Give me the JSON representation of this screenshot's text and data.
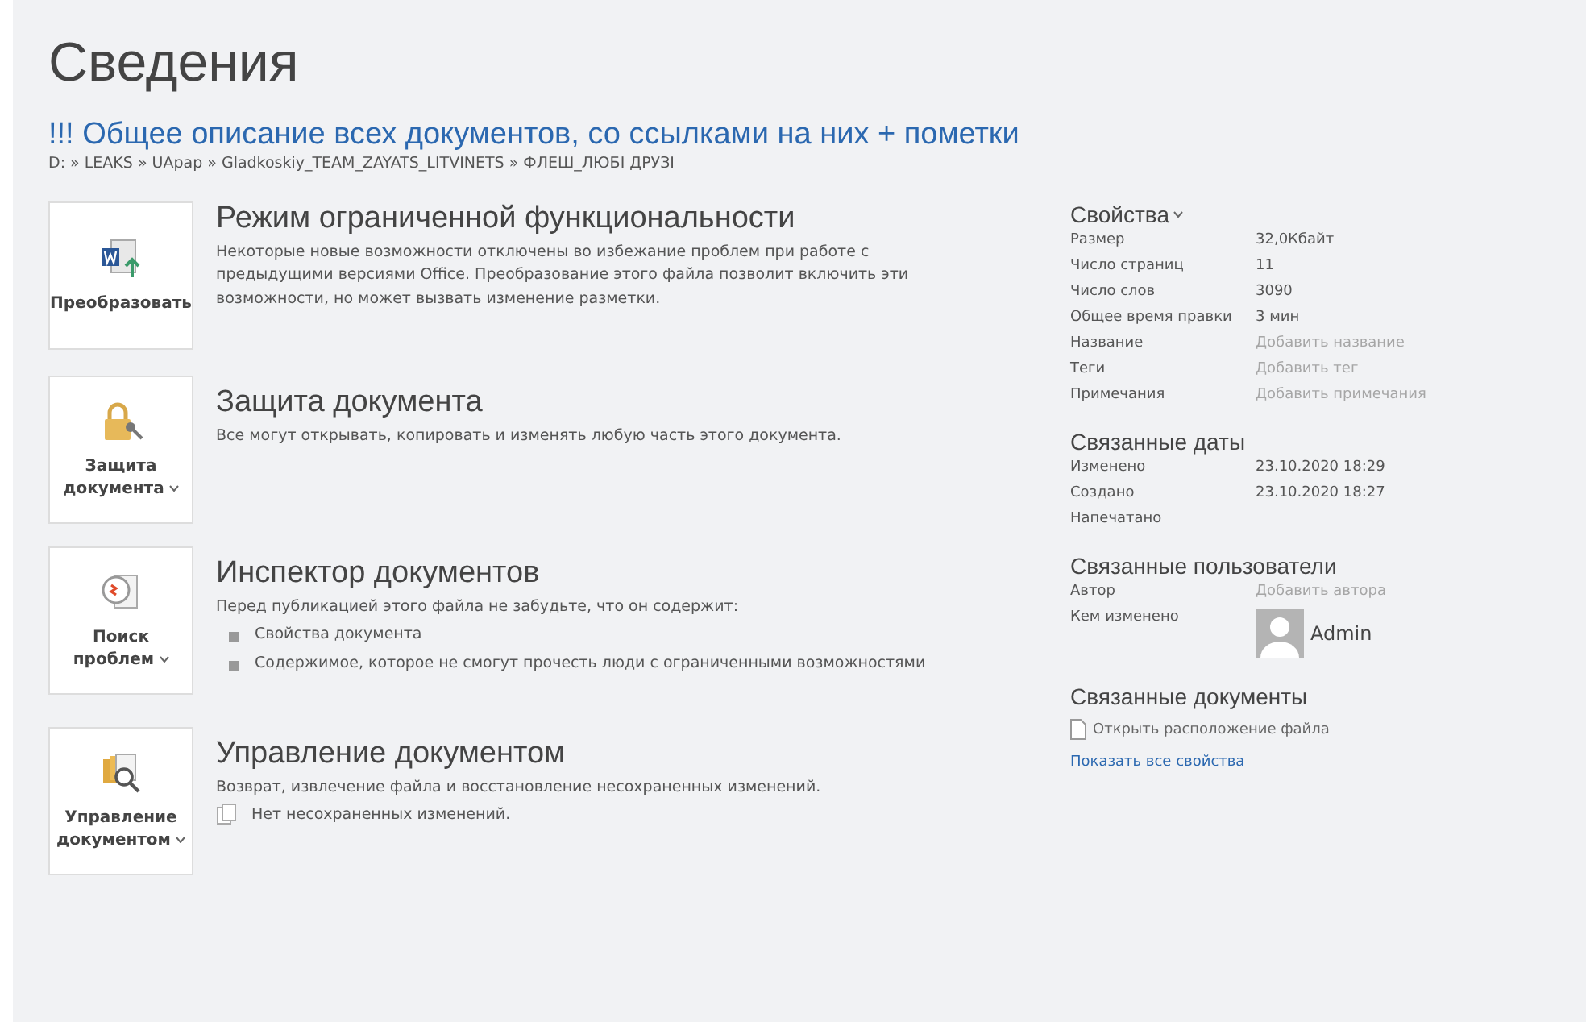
{
  "page": {
    "title": "Сведения",
    "document_title": "!!! Общее описание всех документов, со ссылками на них + пометки",
    "path": "D: » LEAKS » UApap » Gladkoskiy_TEAM_ZAYATS_LITVINETS » ФЛЕШ_ЛЮБІ ДРУЗІ"
  },
  "sections": [
    {
      "button": {
        "label": "Преобразовать",
        "kind": "convert",
        "dropdown": false
      },
      "heading": "Режим ограниченной функциональности",
      "description": "Некоторые новые возможности отключены во избежание проблем при работе с предыдущими версиями Office. Преобразование этого файла позволит включить эти возможности, но может вызвать изменение разметки."
    },
    {
      "button": {
        "label": "Защита документа",
        "kind": "protect",
        "dropdown": true
      },
      "heading": "Защита документа",
      "description": "Все могут открывать, копировать и изменять любую часть этого документа."
    },
    {
      "button": {
        "label": "Поиск проблем",
        "kind": "inspect",
        "dropdown": true
      },
      "heading": "Инспектор документов",
      "description": "Перед публикацией этого файла не забудьте, что он содержит:",
      "bullets": [
        "Свойства документа",
        "Содержимое, которое не смогут прочесть люди с ограниченными возможностями"
      ]
    },
    {
      "button": {
        "label": "Управление документом",
        "kind": "manage",
        "dropdown": true
      },
      "heading": "Управление документом",
      "description": "Возврат, извлечение файла и восстановление несохраненных изменений.",
      "note": "Нет несохраненных изменений."
    }
  ],
  "properties": {
    "title": "Свойства",
    "dropdown": true,
    "rows": [
      {
        "label": "Размер",
        "value": "32,0Кбайт"
      },
      {
        "label": "Число страниц",
        "value": "11"
      },
      {
        "label": "Число слов",
        "value": "3090"
      },
      {
        "label": "Общее время правки",
        "value": "3 мин"
      },
      {
        "label": "Название",
        "placeholder": "Добавить название"
      },
      {
        "label": "Теги",
        "placeholder": "Добавить тег"
      },
      {
        "label": "Примечания",
        "placeholder": "Добавить примечания"
      }
    ]
  },
  "related_dates": {
    "title": "Связанные даты",
    "rows": [
      {
        "label": "Изменено",
        "value": "23.10.2020 18:29"
      },
      {
        "label": "Создано",
        "value": "23.10.2020 18:27"
      },
      {
        "label": "Напечатано"
      }
    ]
  },
  "related_people": {
    "title": "Связанные пользователи",
    "rows": [
      {
        "label": "Автор",
        "placeholder": "Добавить автора"
      },
      {
        "label": "Кем изменено",
        "user": "Admin"
      }
    ]
  },
  "related_documents": {
    "title": "Связанные документы",
    "link": "Открыть расположение файла"
  },
  "show_all_link": "Показать все свойства"
}
